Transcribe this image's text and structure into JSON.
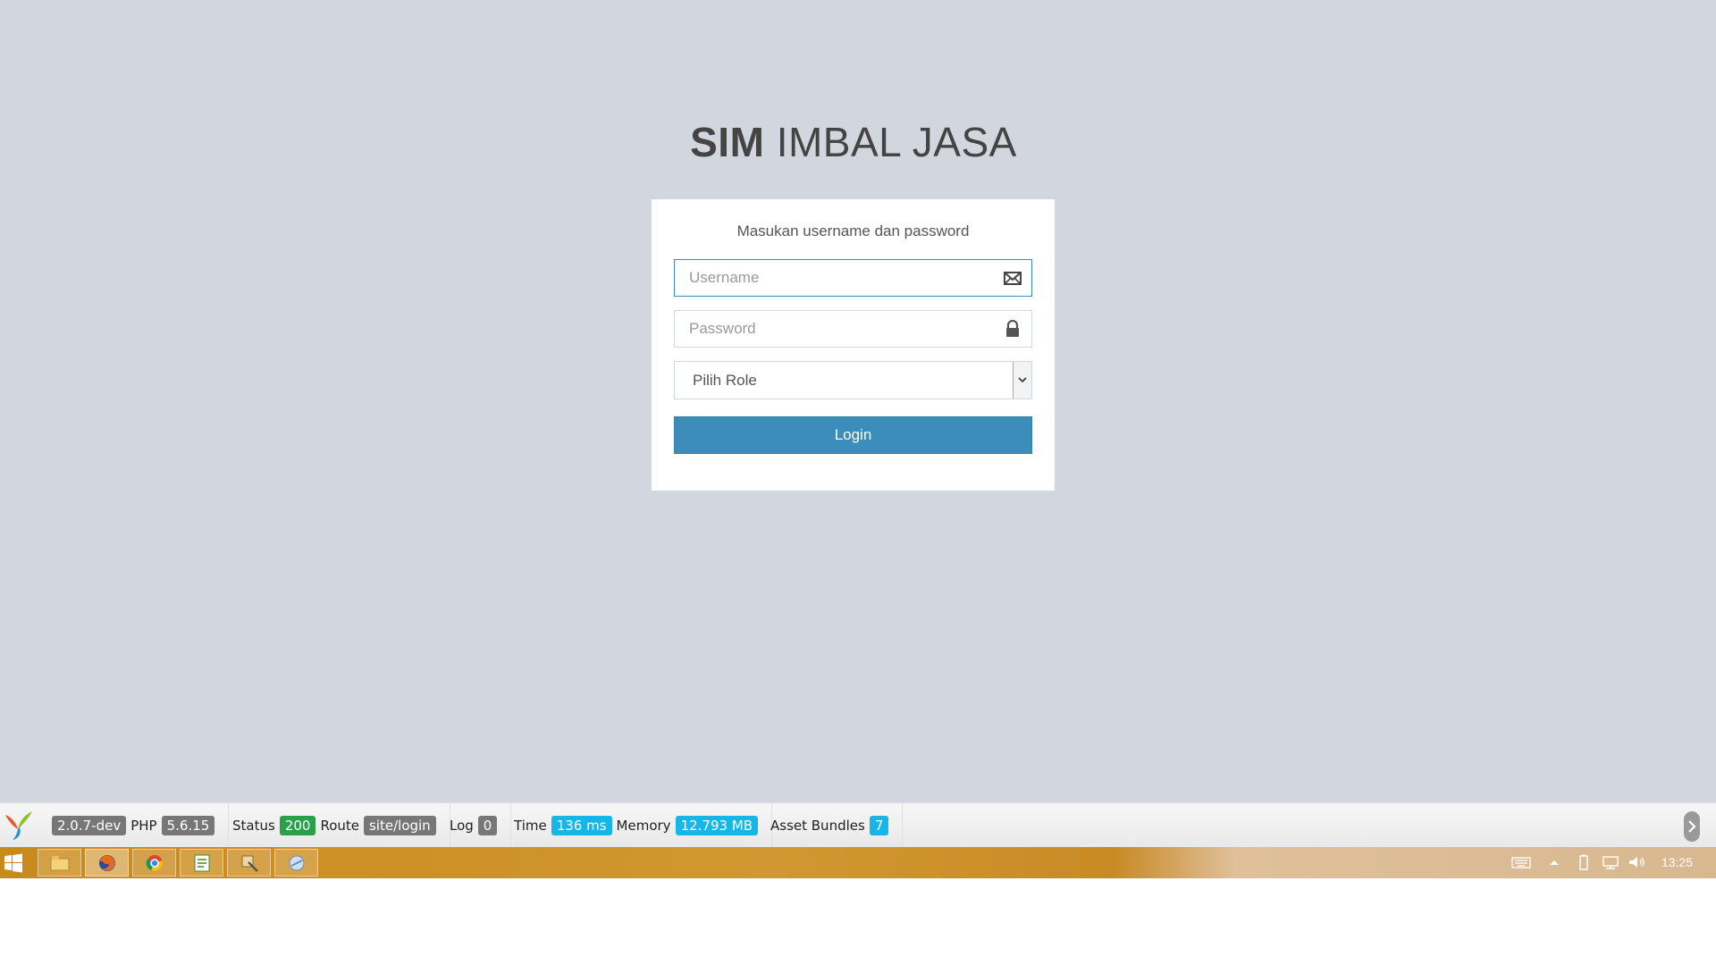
{
  "app": {
    "logo_bold": "SIM",
    "logo_light": "IMBAL JASA"
  },
  "login": {
    "message": "Masukan username dan password",
    "username_placeholder": "Username",
    "password_placeholder": "Password",
    "role_select_value": "Pilih Role",
    "login_button": "Login",
    "username_icon": "envelope-icon",
    "password_icon": "lock-icon"
  },
  "debug_toolbar": {
    "version": "2.0.7-dev",
    "php_label": "PHP",
    "php_version": "5.6.15",
    "status_label": "Status",
    "status_code": "200",
    "route_label": "Route",
    "route_value": "site/login",
    "log_label": "Log",
    "log_count": "0",
    "time_label": "Time",
    "time_value": "136 ms",
    "memory_label": "Memory",
    "memory_value": "12.793 MB",
    "assets_label": "Asset Bundles",
    "assets_count": "7"
  },
  "taskbar": {
    "apps": [
      "file-explorer-icon",
      "firefox-icon",
      "chrome-icon",
      "notepad-icon",
      "tool-icon",
      "network-app-icon"
    ],
    "clock": "13:25"
  },
  "colors": {
    "background": "#d2d6de",
    "primary": "#3c8dbc",
    "badge_green": "#2aa04a",
    "badge_blue": "#16b6e6",
    "badge_gray": "#777777"
  }
}
